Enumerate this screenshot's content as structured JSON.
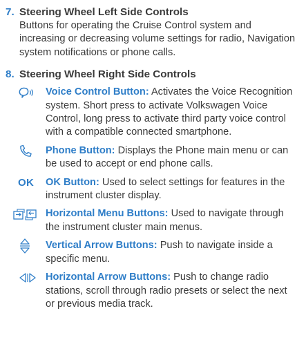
{
  "colors": {
    "accent": "#2f7ec8",
    "text": "#3a3a3a"
  },
  "section7": {
    "number": "7.",
    "title": "Steering Wheel Left Side Controls",
    "description": "Buttons for operating the Cruise Control system and increasing or decreasing volume settings for radio, Navigation system notifications or phone calls."
  },
  "section8": {
    "number": "8.",
    "title": "Steering Wheel Right Side Controls",
    "items": [
      {
        "icon": "voice-control-icon",
        "label": "Voice Control Button:",
        "text": "Activates the Voice Recognition system. Short press to activate Volkswagen Voice Control, long press to activate third party voice control with a compatible connected smartphone."
      },
      {
        "icon": "phone-icon",
        "label": "Phone Button:",
        "text": "Displays the Phone main menu or can be used to accept or end phone calls."
      },
      {
        "icon": "ok-icon",
        "icon_text": "OK",
        "label": "OK Button:",
        "text": "Used to select settings for features in the instrument cluster display."
      },
      {
        "icon": "horizontal-menu-icon",
        "label": "Horizontal Menu Buttons:",
        "text": "Used to navigate through the instrument cluster main menus."
      },
      {
        "icon": "vertical-arrows-icon",
        "label": "Vertical Arrow Buttons:",
        "text": "Push to navigate inside a specific menu."
      },
      {
        "icon": "horizontal-arrows-icon",
        "label": "Horizontal Arrow Buttons:",
        "text": "Push to change radio stations, scroll through radio presets or select the next or previous media track."
      }
    ]
  }
}
